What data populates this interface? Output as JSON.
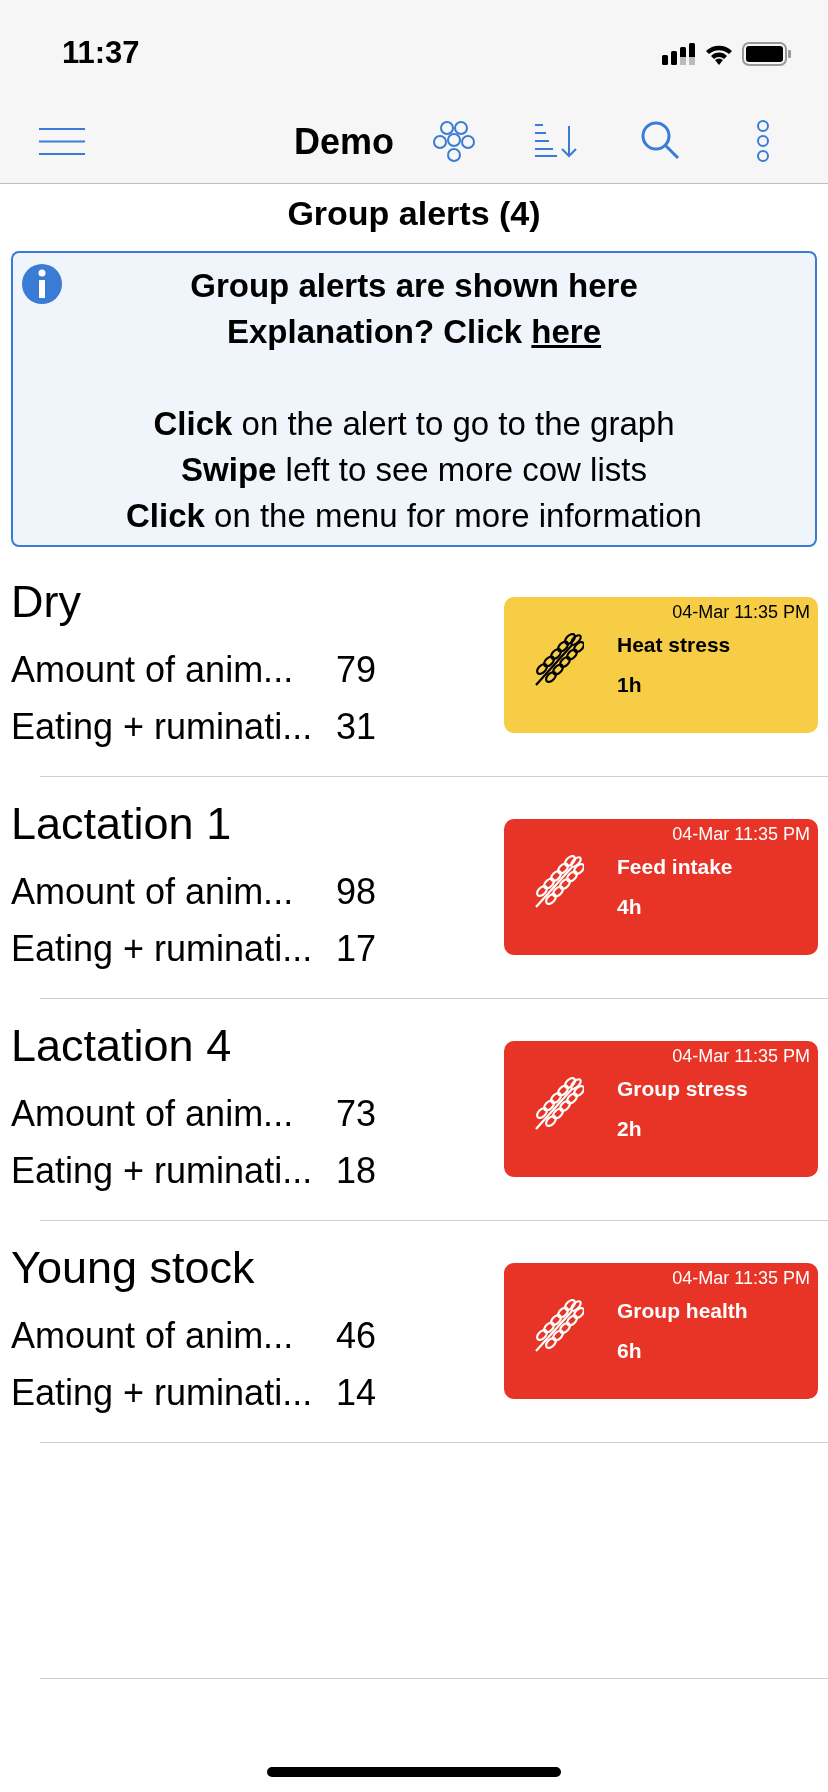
{
  "status_bar": {
    "time": "11:37"
  },
  "nav": {
    "title": "Demo"
  },
  "page_title": "Group alerts (4)",
  "info": {
    "line1": "Group alerts are shown here",
    "line2_prefix": "Explanation? Click",
    "link": "here",
    "tips": [
      "**Click** on the alert to go to the graph",
      "**Swipe** left to see more cow lists",
      "**Click** on the menu for more information"
    ]
  },
  "groups": [
    {
      "name": "Dry",
      "rows": [
        {
          "label": "Amount of anim...",
          "value": "79"
        },
        {
          "label": "Eating + ruminati...",
          "value": "31"
        }
      ],
      "alert": {
        "color": "#f6cd45",
        "time": "04-Mar 11:35 PM",
        "title": "Heat stress",
        "duration": "1h"
      }
    },
    {
      "name": "Lactation 1",
      "rows": [
        {
          "label": "Amount of anim...",
          "value": "98"
        },
        {
          "label": "Eating + ruminati...",
          "value": "17"
        }
      ],
      "alert": {
        "color": "#e83426",
        "time": "04-Mar 11:35 PM",
        "title": "Feed intake",
        "duration": "4h"
      }
    },
    {
      "name": "Lactation 4",
      "rows": [
        {
          "label": "Amount of anim...",
          "value": "73"
        },
        {
          "label": "Eating + ruminati...",
          "value": "18"
        }
      ],
      "alert": {
        "color": "#e83426",
        "time": "04-Mar 11:35 PM",
        "title": "Group stress",
        "duration": "2h"
      }
    },
    {
      "name": "Young stock",
      "rows": [
        {
          "label": "Amount of anim...",
          "value": "46"
        },
        {
          "label": "Eating + ruminati...",
          "value": "14"
        }
      ],
      "alert": {
        "color": "#e83426",
        "time": "04-Mar 11:35 PM",
        "title": "Group health",
        "duration": "6h"
      }
    }
  ]
}
